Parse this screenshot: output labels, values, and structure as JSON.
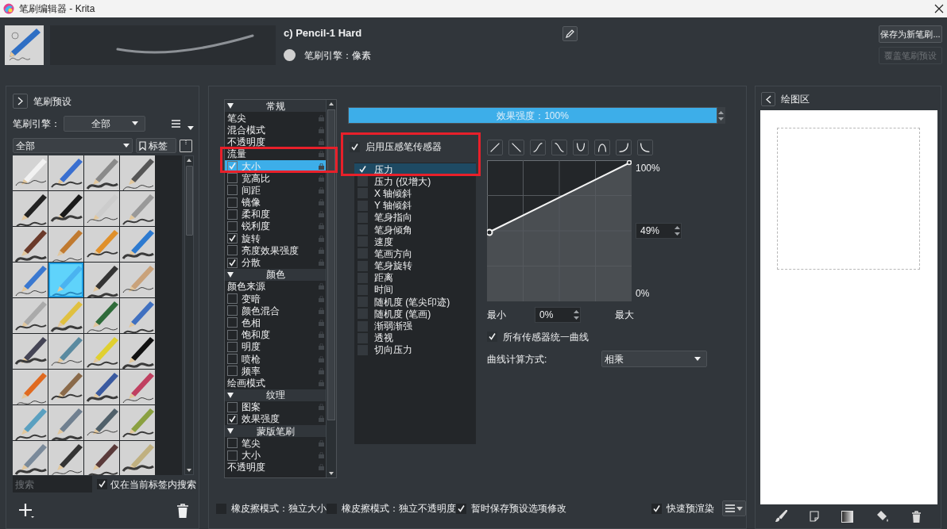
{
  "window": {
    "title": "笔刷编辑器 - Krita"
  },
  "preset_header": {
    "name": "c) Pencil-1 Hard",
    "engine": "笔刷引擎：像素",
    "buttons": [
      {
        "label": "保存为新笔刷...",
        "disabled": false
      },
      {
        "label": "覆盖笔刷预设",
        "disabled": true
      }
    ]
  },
  "presets_panel": {
    "title": "笔刷预设",
    "engine_label": "笔刷引擎：",
    "engine_value": "全部",
    "tag_value": "全部",
    "tag_button": "标签",
    "search_placeholder": "搜索",
    "search_in_tag": {
      "label": "仅在当前标签内搜索",
      "checked": true
    },
    "presets": [
      {
        "selected": false
      },
      {
        "selected": false
      },
      {
        "selected": false
      },
      {
        "selected": false
      },
      {
        "selected": false
      },
      {
        "selected": false
      },
      {
        "selected": false
      },
      {
        "selected": false
      },
      {
        "selected": false
      },
      {
        "selected": false
      },
      {
        "selected": false
      },
      {
        "selected": false
      },
      {
        "selected": false
      },
      {
        "selected": true
      },
      {
        "selected": false
      },
      {
        "selected": false
      },
      {
        "selected": false
      },
      {
        "selected": false
      },
      {
        "selected": false
      },
      {
        "selected": false
      },
      {
        "selected": false
      },
      {
        "selected": false
      },
      {
        "selected": false
      },
      {
        "selected": false
      },
      {
        "selected": false
      },
      {
        "selected": false
      },
      {
        "selected": false
      },
      {
        "selected": false
      },
      {
        "selected": false
      },
      {
        "selected": false
      },
      {
        "selected": false
      },
      {
        "selected": false
      },
      {
        "selected": false
      },
      {
        "selected": false
      },
      {
        "selected": false
      },
      {
        "selected": false
      }
    ]
  },
  "options": {
    "framed": true,
    "rows": [
      {
        "kind": "section",
        "label": "常规"
      },
      {
        "kind": "plain",
        "label": "笔尖",
        "selected": false
      },
      {
        "kind": "plain",
        "label": "混合模式",
        "selected": false
      },
      {
        "kind": "plain",
        "label": "不透明度",
        "selected": false
      },
      {
        "kind": "plain",
        "label": "流量",
        "selected": false
      },
      {
        "kind": "checkbox",
        "label": "大小",
        "checked": true,
        "selected": true
      },
      {
        "kind": "checkbox",
        "label": "宽高比",
        "checked": false,
        "selected": false
      },
      {
        "kind": "checkbox",
        "label": "间距",
        "checked": false,
        "selected": false
      },
      {
        "kind": "checkbox",
        "label": "镜像",
        "checked": false,
        "selected": false
      },
      {
        "kind": "checkbox",
        "label": "柔和度",
        "checked": false,
        "selected": false
      },
      {
        "kind": "checkbox",
        "label": "锐利度",
        "checked": false,
        "selected": false
      },
      {
        "kind": "checkbox",
        "label": "旋转",
        "checked": true,
        "selected": false
      },
      {
        "kind": "checkbox",
        "label": "亮度效果强度",
        "checked": false,
        "selected": false
      },
      {
        "kind": "checkbox",
        "label": "分散",
        "checked": true,
        "selected": false
      },
      {
        "kind": "section",
        "label": "颜色"
      },
      {
        "kind": "plain",
        "label": "颜色来源",
        "selected": false
      },
      {
        "kind": "checkbox",
        "label": "变暗",
        "checked": false,
        "selected": false
      },
      {
        "kind": "checkbox",
        "label": "颜色混合",
        "checked": false,
        "selected": false
      },
      {
        "kind": "checkbox",
        "label": "色相",
        "checked": false,
        "selected": false
      },
      {
        "kind": "checkbox",
        "label": "饱和度",
        "checked": false,
        "selected": false
      },
      {
        "kind": "checkbox",
        "label": "明度",
        "checked": false,
        "selected": false
      },
      {
        "kind": "checkbox",
        "label": "喷枪",
        "checked": false,
        "selected": false
      },
      {
        "kind": "checkbox",
        "label": "频率",
        "checked": false,
        "selected": false
      },
      {
        "kind": "plain",
        "label": "绘画模式",
        "selected": false
      },
      {
        "kind": "section",
        "label": "纹理"
      },
      {
        "kind": "checkbox",
        "label": "图案",
        "checked": false,
        "selected": false
      },
      {
        "kind": "checkbox",
        "label": "效果强度",
        "checked": true,
        "selected": false
      },
      {
        "kind": "section",
        "label": "蒙版笔刷"
      },
      {
        "kind": "checkbox",
        "label": "笔尖",
        "checked": false,
        "selected": false
      },
      {
        "kind": "checkbox",
        "label": "大小",
        "checked": false,
        "selected": false
      },
      {
        "kind": "plain",
        "label": "不透明度",
        "selected": false
      }
    ]
  },
  "strength": {
    "label": "效果强度：100%",
    "level": 1.0
  },
  "sensors": {
    "framed": true,
    "enabled": {
      "label": "启用压感笔传感器",
      "checked": true
    },
    "items": [
      {
        "label": "压力",
        "checked": true,
        "selected": true
      },
      {
        "label": "压力 (仅增大)",
        "checked": false,
        "selected": false
      },
      {
        "label": "X 轴倾斜",
        "checked": false,
        "selected": false
      },
      {
        "label": "Y 轴倾斜",
        "checked": false,
        "selected": false
      },
      {
        "label": "笔身指向",
        "checked": false,
        "selected": false
      },
      {
        "label": "笔身倾角",
        "checked": false,
        "selected": false
      },
      {
        "label": "速度",
        "checked": false,
        "selected": false
      },
      {
        "label": "笔画方向",
        "checked": false,
        "selected": false
      },
      {
        "label": "笔身旋转",
        "checked": false,
        "selected": false
      },
      {
        "label": "距离",
        "checked": false,
        "selected": false
      },
      {
        "label": "时间",
        "checked": false,
        "selected": false
      },
      {
        "label": "随机度 (笔尖印迹)",
        "checked": false,
        "selected": false
      },
      {
        "label": "随机度 (笔画)",
        "checked": false,
        "selected": false
      },
      {
        "label": "渐弱渐强",
        "checked": false,
        "selected": false
      },
      {
        "label": "透视",
        "checked": false,
        "selected": false
      },
      {
        "label": "切向压力",
        "checked": false,
        "selected": false
      }
    ]
  },
  "curve": {
    "top_label": "100%",
    "value": "49%",
    "bottom_label": "0%",
    "min_text": "最小",
    "min_value": "0%",
    "max_text": "最大",
    "shared_curve": {
      "label": "所有传感器统一曲线",
      "checked": true
    },
    "mode_label": "曲线计算方式:",
    "mode_value": "相乘"
  },
  "bottom_bar": {
    "options": [
      {
        "label": "橡皮擦模式：独立大小",
        "checked": false
      },
      {
        "label": "橡皮擦模式：独立不透明度",
        "checked": false
      },
      {
        "label": "暂时保存预设选项修改",
        "checked": true
      },
      {
        "label": "快速预渲染",
        "checked": true
      }
    ]
  },
  "scratchpad": {
    "title": "绘图区"
  }
}
